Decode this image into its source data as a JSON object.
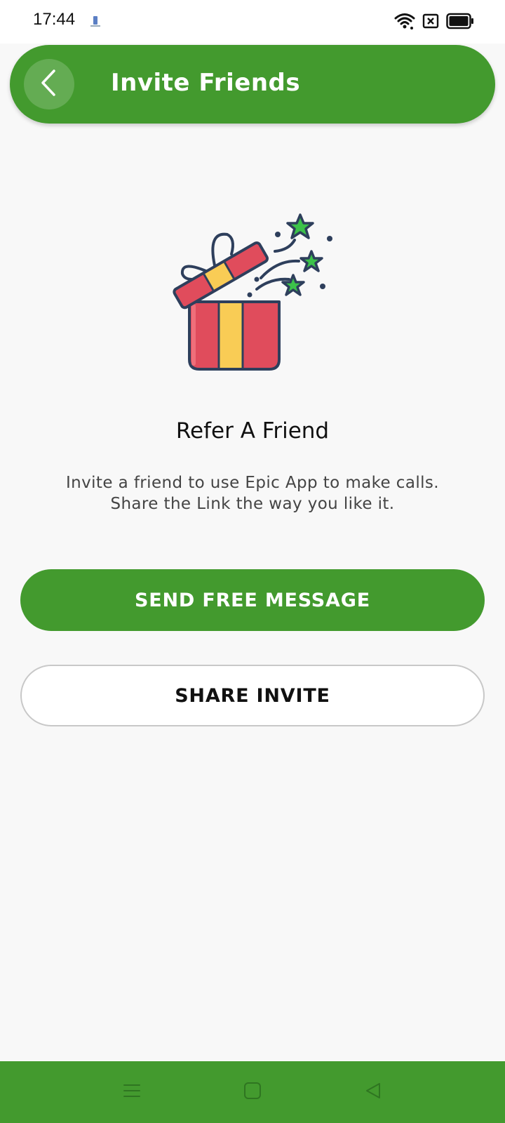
{
  "status_bar": {
    "time": "17:44",
    "icons": [
      "app-notification-icon",
      "wifi-icon",
      "sim-off-icon",
      "battery-icon"
    ]
  },
  "header": {
    "title": "Invite Friends",
    "back_icon": "chevron-left-icon"
  },
  "content": {
    "illustration": "gift-box-icon",
    "title": "Refer A Friend",
    "description_line1": "Invite a friend to use Epic App to make calls.",
    "description_line2": "Share the Link the way you like it."
  },
  "actions": {
    "send_free_message": "SEND FREE MESSAGE",
    "share_invite": "SHARE INVITE"
  },
  "nav_bar": {
    "icons": [
      "menu-icon",
      "home-icon",
      "back-icon"
    ]
  },
  "colors": {
    "accent": "#439a2e",
    "background": "#f8f8f8",
    "gift_red": "#e04c5c",
    "gift_yellow": "#f9cc55",
    "star_green": "#3cc24a",
    "outline": "#2e3f5c"
  }
}
